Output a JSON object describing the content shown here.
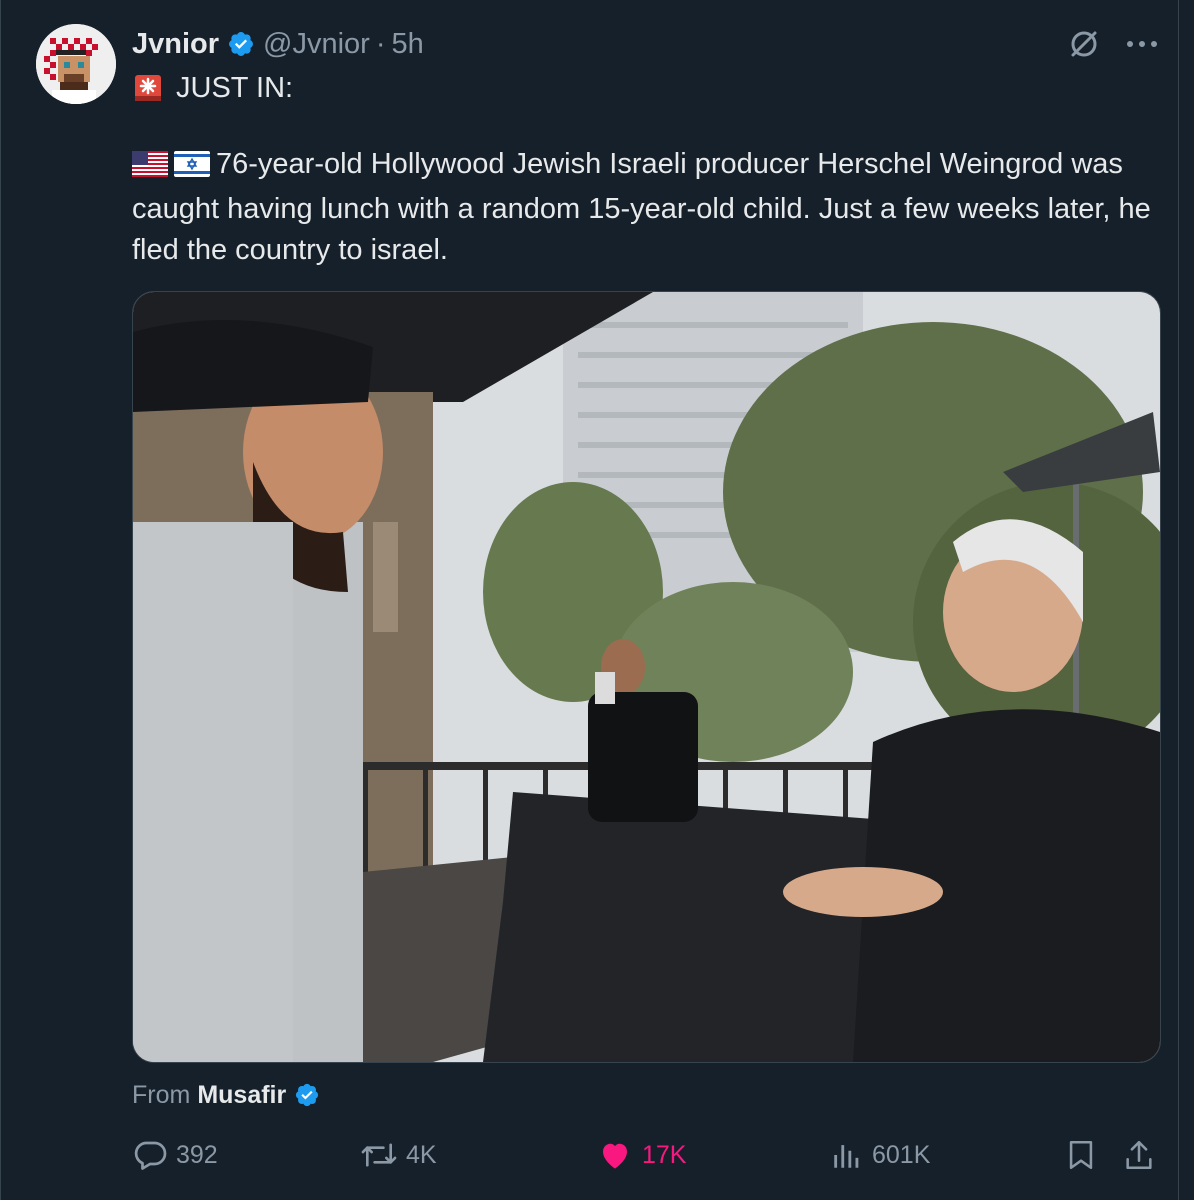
{
  "colors": {
    "background": "#15202b",
    "text": "#e7e9ea",
    "muted": "#8b98a5",
    "verified": "#1d9bf0",
    "like": "#f91880",
    "border": "#38444d"
  },
  "author": {
    "display_name": "Jvnior",
    "handle": "@Jvnior",
    "separator": "·",
    "time": "5h"
  },
  "tweet": {
    "headline": "JUST IN:",
    "body": "76-year-old Hollywood Jewish Israeli producer Herschel Weingrod was caught having lunch with a random 15-year-old child. Just a few weeks later, he fled the country to israel."
  },
  "media_source": {
    "prefix": "From",
    "name": "Musafir"
  },
  "actions": {
    "replies": "392",
    "reposts": "4K",
    "likes": "17K",
    "views": "601K"
  },
  "icons": [
    "siren-icon",
    "us-flag-icon",
    "israel-flag-icon",
    "grok-icon",
    "more-icon",
    "verified-icon",
    "reply-icon",
    "repost-icon",
    "heart-icon",
    "views-icon",
    "bookmark-icon",
    "share-icon"
  ]
}
